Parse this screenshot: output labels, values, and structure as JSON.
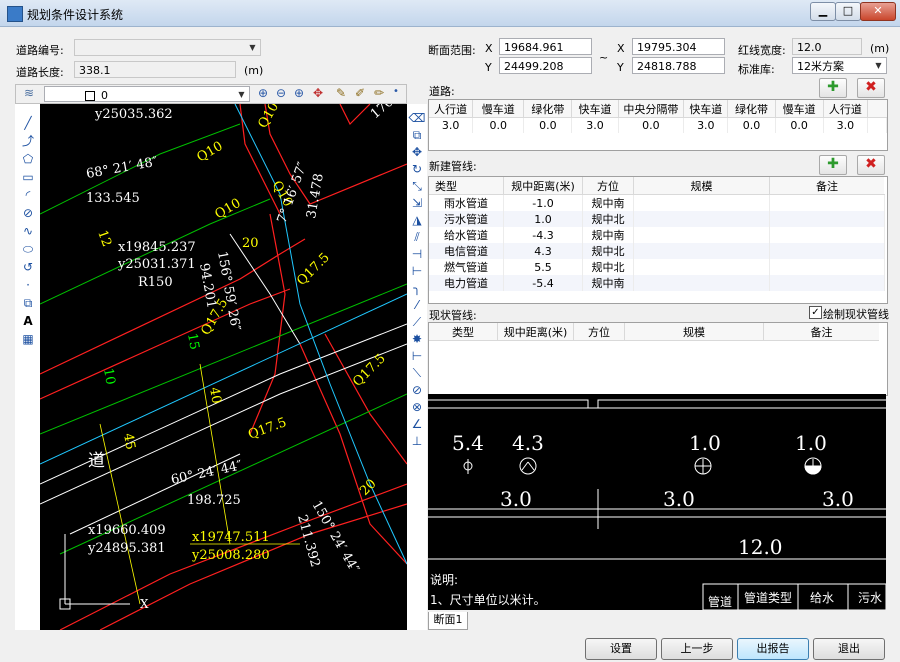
{
  "window": {
    "title": "规划条件设计系统",
    "minimize_icon": "minimize-icon",
    "maximize_icon": "maximize-icon",
    "close_icon": "close-icon"
  },
  "road_info": {
    "road_no_label": "道路编号:",
    "road_no_value": "",
    "length_label": "道路长度:",
    "length_value": "338.1",
    "length_unit": "(m)"
  },
  "section_range": {
    "label": "断面范围:",
    "x1_label": "X",
    "x1": "19684.961",
    "y1_label": "Y",
    "y1": "24499.208",
    "tilde": "~",
    "x2_label": "X",
    "x2": "19795.304",
    "y2_label": "Y",
    "y2": "24818.788"
  },
  "redline": {
    "width_label": "红线宽度:",
    "width_value": "12.0",
    "unit": "(m)",
    "standard_label": "标准库:",
    "standard_value": "12米方案"
  },
  "cad_toolbar": {
    "layer_value": "0"
  },
  "cad_drawing": {
    "texts": [
      {
        "t": "y25035.362",
        "c": "#ffffff"
      },
      {
        "t": "68° 21′ 48″",
        "c": "#ffffff"
      },
      {
        "t": "133.545",
        "c": "#ffffff"
      },
      {
        "t": "Q10",
        "c": "#ffff00"
      },
      {
        "t": "Q10",
        "c": "#ffff00"
      },
      {
        "t": "Q10",
        "c": "#ffff00"
      },
      {
        "t": "Q10",
        "c": "#ffff00"
      },
      {
        "t": "7° 16′ 57″",
        "c": "#ffffff"
      },
      {
        "t": "31.478",
        "c": "#ffffff"
      },
      {
        "t": "12",
        "c": "#ffff00"
      },
      {
        "t": "x19845.237",
        "c": "#ffffff"
      },
      {
        "t": "y25031.371",
        "c": "#ffffff"
      },
      {
        "t": "R150",
        "c": "#ffffff"
      },
      {
        "t": "94.201",
        "c": "#ffffff"
      },
      {
        "t": "156° 59′ 26″",
        "c": "#ffffff"
      },
      {
        "t": "Q17.5",
        "c": "#ffff00"
      },
      {
        "t": "Q17.5",
        "c": "#ffff00"
      },
      {
        "t": "Q17.5",
        "c": "#ffff00"
      },
      {
        "t": "Q17.5",
        "c": "#ffff00"
      },
      {
        "t": "20",
        "c": "#ffff00"
      },
      {
        "t": "15",
        "c": "#00ff00"
      },
      {
        "t": "10",
        "c": "#00ff00"
      },
      {
        "t": "40",
        "c": "#ffff00"
      },
      {
        "t": "45",
        "c": "#ffff00"
      },
      {
        "t": "道",
        "c": "#ffffff"
      },
      {
        "t": "60° 24′ 44″",
        "c": "#ffffff"
      },
      {
        "t": "198.725",
        "c": "#ffffff"
      },
      {
        "t": "150° 24′ 44″",
        "c": "#ffffff"
      },
      {
        "t": "211.392",
        "c": "#ffffff"
      },
      {
        "t": "20",
        "c": "#ffff00"
      },
      {
        "t": "x19660.409",
        "c": "#ffffff"
      },
      {
        "t": "y24895.381",
        "c": "#ffffff"
      },
      {
        "t": "x19747.511",
        "c": "#ffff00"
      },
      {
        "t": "y25008.280",
        "c": "#ffff00"
      },
      {
        "t": "170.",
        "c": "#ffffff"
      },
      {
        "t": "X",
        "c": "#ffffff"
      }
    ]
  },
  "road_grid": {
    "label": "道路:",
    "add_icon": "plus-icon",
    "delete_icon": "delete-x-icon",
    "headers": [
      "人行道",
      "慢车道",
      "绿化带",
      "快车道",
      "中央分隔带",
      "快车道",
      "绿化带",
      "慢车道",
      "人行道"
    ],
    "rows": [
      [
        "3.0",
        "0.0",
        "0.0",
        "3.0",
        "0.0",
        "3.0",
        "0.0",
        "0.0",
        "3.0"
      ]
    ]
  },
  "new_pipe_grid": {
    "label": "新建管线:",
    "add_icon": "plus-icon",
    "delete_icon": "delete-x-icon",
    "headers": [
      "类型",
      "规中距离(米)",
      "方位",
      "规模",
      "备注"
    ],
    "rows": [
      [
        "雨水管道",
        "-1.0",
        "规中南",
        "",
        ""
      ],
      [
        "污水管道",
        "1.0",
        "规中北",
        "",
        ""
      ],
      [
        "给水管道",
        "-4.3",
        "规中南",
        "",
        ""
      ],
      [
        "电信管道",
        "4.3",
        "规中北",
        "",
        ""
      ],
      [
        "燃气管道",
        "5.5",
        "规中北",
        "",
        ""
      ],
      [
        "电力管道",
        "-5.4",
        "规中南",
        "",
        ""
      ]
    ]
  },
  "existing_pipe_grid": {
    "label": "现状管线:",
    "draw_check_label": "绘制现状管线",
    "draw_checked": true,
    "headers": [
      "类型",
      "规中距离(米)",
      "方位",
      "规模",
      "备注"
    ]
  },
  "cross_section": {
    "pipe_values": [
      "5.4",
      "4.3",
      "1.0",
      "1.0"
    ],
    "lane_values": [
      "3.0",
      "3.0",
      "3.0"
    ],
    "total_width": "12.0",
    "notes_title": "说明:",
    "note1": "1、尺寸单位以米计。",
    "legend_headers": [
      "管道类型",
      "给水",
      "污水"
    ],
    "legend_left": "管道",
    "tab_label": "断面1"
  },
  "footer": {
    "settings": "设置",
    "prev": "上一步",
    "report": "出报告",
    "exit": "退出"
  }
}
